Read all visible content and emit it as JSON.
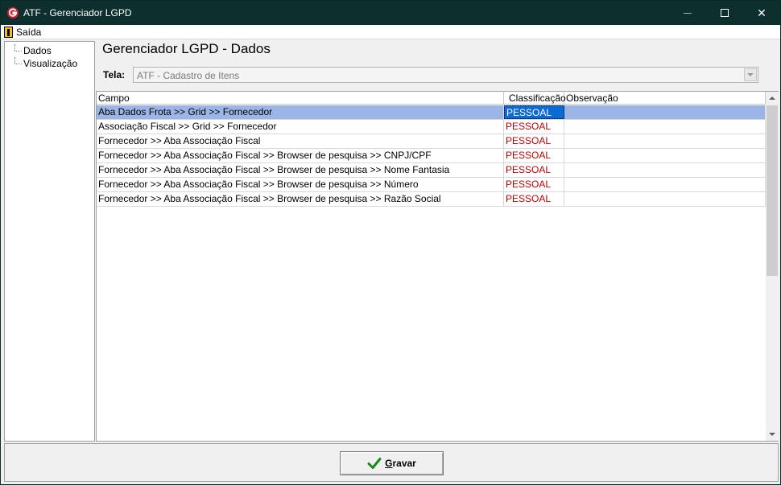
{
  "window": {
    "title": "ATF - Gerenciador LGPD",
    "minimize_label": "Minimize",
    "maximize_label": "Maximize",
    "close_label": "✕"
  },
  "menu": {
    "exit_label": "Saída"
  },
  "tree": {
    "items": [
      {
        "label": "Dados"
      },
      {
        "label": "Visualização"
      }
    ]
  },
  "main": {
    "title": "Gerenciador LGPD - Dados",
    "tela_label": "Tela:",
    "tela_value": "ATF - Cadastro de Itens"
  },
  "grid": {
    "columns": [
      "Campo",
      "Classificação",
      "Observação"
    ],
    "rows": [
      {
        "campo": "Aba Dados Frota >> Grid >> Fornecedor",
        "classificacao": "PESSOAL",
        "observacao": "",
        "selected": true
      },
      {
        "campo": "Associação Fiscal >> Grid >> Fornecedor",
        "classificacao": "PESSOAL",
        "observacao": ""
      },
      {
        "campo": "Fornecedor >> Aba Associação Fiscal",
        "classificacao": "PESSOAL",
        "observacao": ""
      },
      {
        "campo": "Fornecedor >> Aba Associação Fiscal >> Browser de pesquisa >> CNPJ/CPF",
        "classificacao": "PESSOAL",
        "observacao": ""
      },
      {
        "campo": "Fornecedor >> Aba Associação Fiscal >> Browser de pesquisa >> Nome Fantasia",
        "classificacao": "PESSOAL",
        "observacao": ""
      },
      {
        "campo": "Fornecedor >> Aba Associação Fiscal >> Browser de pesquisa >> Número",
        "classificacao": "PESSOAL",
        "observacao": ""
      },
      {
        "campo": "Fornecedor >> Aba Associação Fiscal >> Browser de pesquisa >> Razão Social",
        "classificacao": "PESSOAL",
        "observacao": ""
      }
    ]
  },
  "footer": {
    "save_label_first": "G",
    "save_label_rest": "ravar"
  },
  "colors": {
    "titlebar": "#0d2f2e",
    "classification": "#c00000",
    "selection": "#9ab5e6",
    "selection_cell": "#0a6ad6"
  }
}
